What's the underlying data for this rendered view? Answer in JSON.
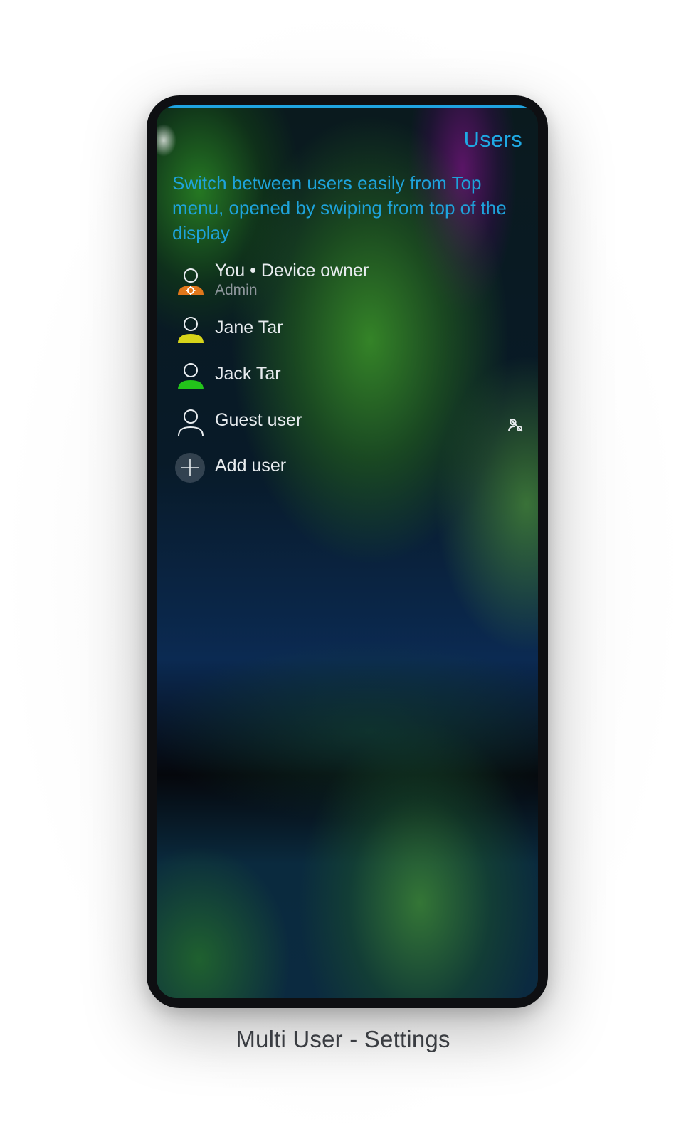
{
  "screen": {
    "header_title": "Users",
    "hint_text": "Switch between users easily from Top menu, opened by swiping from top of the display",
    "accent_color": "#1fa3e0"
  },
  "users": [
    {
      "name": "You • Device owner",
      "subtitle": "Admin",
      "icon": "admin-user-icon",
      "color": "#e0771b"
    },
    {
      "name": "Jane Tar",
      "icon": "user-icon",
      "color": "#d7d41a"
    },
    {
      "name": "Jack Tar",
      "icon": "user-icon",
      "color": "#23c41a"
    },
    {
      "name": "Guest user",
      "icon": "user-outline-icon",
      "action_icon": "guest-toggle-icon"
    }
  ],
  "add_user": {
    "label": "Add user",
    "icon": "add-icon"
  },
  "caption": "Multi User -  Settings"
}
